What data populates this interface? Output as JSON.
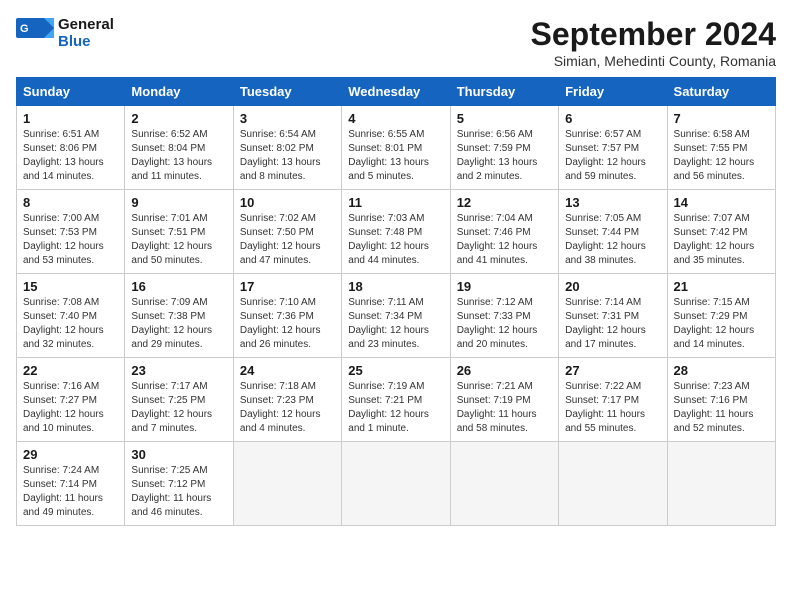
{
  "header": {
    "logo_general": "General",
    "logo_blue": "Blue",
    "month_title": "September 2024",
    "location": "Simian, Mehedinti County, Romania"
  },
  "weekdays": [
    "Sunday",
    "Monday",
    "Tuesday",
    "Wednesday",
    "Thursday",
    "Friday",
    "Saturday"
  ],
  "weeks": [
    [
      {
        "day": "1",
        "info": "Sunrise: 6:51 AM\nSunset: 8:06 PM\nDaylight: 13 hours\nand 14 minutes."
      },
      {
        "day": "2",
        "info": "Sunrise: 6:52 AM\nSunset: 8:04 PM\nDaylight: 13 hours\nand 11 minutes."
      },
      {
        "day": "3",
        "info": "Sunrise: 6:54 AM\nSunset: 8:02 PM\nDaylight: 13 hours\nand 8 minutes."
      },
      {
        "day": "4",
        "info": "Sunrise: 6:55 AM\nSunset: 8:01 PM\nDaylight: 13 hours\nand 5 minutes."
      },
      {
        "day": "5",
        "info": "Sunrise: 6:56 AM\nSunset: 7:59 PM\nDaylight: 13 hours\nand 2 minutes."
      },
      {
        "day": "6",
        "info": "Sunrise: 6:57 AM\nSunset: 7:57 PM\nDaylight: 12 hours\nand 59 minutes."
      },
      {
        "day": "7",
        "info": "Sunrise: 6:58 AM\nSunset: 7:55 PM\nDaylight: 12 hours\nand 56 minutes."
      }
    ],
    [
      {
        "day": "8",
        "info": "Sunrise: 7:00 AM\nSunset: 7:53 PM\nDaylight: 12 hours\nand 53 minutes."
      },
      {
        "day": "9",
        "info": "Sunrise: 7:01 AM\nSunset: 7:51 PM\nDaylight: 12 hours\nand 50 minutes."
      },
      {
        "day": "10",
        "info": "Sunrise: 7:02 AM\nSunset: 7:50 PM\nDaylight: 12 hours\nand 47 minutes."
      },
      {
        "day": "11",
        "info": "Sunrise: 7:03 AM\nSunset: 7:48 PM\nDaylight: 12 hours\nand 44 minutes."
      },
      {
        "day": "12",
        "info": "Sunrise: 7:04 AM\nSunset: 7:46 PM\nDaylight: 12 hours\nand 41 minutes."
      },
      {
        "day": "13",
        "info": "Sunrise: 7:05 AM\nSunset: 7:44 PM\nDaylight: 12 hours\nand 38 minutes."
      },
      {
        "day": "14",
        "info": "Sunrise: 7:07 AM\nSunset: 7:42 PM\nDaylight: 12 hours\nand 35 minutes."
      }
    ],
    [
      {
        "day": "15",
        "info": "Sunrise: 7:08 AM\nSunset: 7:40 PM\nDaylight: 12 hours\nand 32 minutes."
      },
      {
        "day": "16",
        "info": "Sunrise: 7:09 AM\nSunset: 7:38 PM\nDaylight: 12 hours\nand 29 minutes."
      },
      {
        "day": "17",
        "info": "Sunrise: 7:10 AM\nSunset: 7:36 PM\nDaylight: 12 hours\nand 26 minutes."
      },
      {
        "day": "18",
        "info": "Sunrise: 7:11 AM\nSunset: 7:34 PM\nDaylight: 12 hours\nand 23 minutes."
      },
      {
        "day": "19",
        "info": "Sunrise: 7:12 AM\nSunset: 7:33 PM\nDaylight: 12 hours\nand 20 minutes."
      },
      {
        "day": "20",
        "info": "Sunrise: 7:14 AM\nSunset: 7:31 PM\nDaylight: 12 hours\nand 17 minutes."
      },
      {
        "day": "21",
        "info": "Sunrise: 7:15 AM\nSunset: 7:29 PM\nDaylight: 12 hours\nand 14 minutes."
      }
    ],
    [
      {
        "day": "22",
        "info": "Sunrise: 7:16 AM\nSunset: 7:27 PM\nDaylight: 12 hours\nand 10 minutes."
      },
      {
        "day": "23",
        "info": "Sunrise: 7:17 AM\nSunset: 7:25 PM\nDaylight: 12 hours\nand 7 minutes."
      },
      {
        "day": "24",
        "info": "Sunrise: 7:18 AM\nSunset: 7:23 PM\nDaylight: 12 hours\nand 4 minutes."
      },
      {
        "day": "25",
        "info": "Sunrise: 7:19 AM\nSunset: 7:21 PM\nDaylight: 12 hours\nand 1 minute."
      },
      {
        "day": "26",
        "info": "Sunrise: 7:21 AM\nSunset: 7:19 PM\nDaylight: 11 hours\nand 58 minutes."
      },
      {
        "day": "27",
        "info": "Sunrise: 7:22 AM\nSunset: 7:17 PM\nDaylight: 11 hours\nand 55 minutes."
      },
      {
        "day": "28",
        "info": "Sunrise: 7:23 AM\nSunset: 7:16 PM\nDaylight: 11 hours\nand 52 minutes."
      }
    ],
    [
      {
        "day": "29",
        "info": "Sunrise: 7:24 AM\nSunset: 7:14 PM\nDaylight: 11 hours\nand 49 minutes."
      },
      {
        "day": "30",
        "info": "Sunrise: 7:25 AM\nSunset: 7:12 PM\nDaylight: 11 hours\nand 46 minutes."
      },
      {
        "day": "",
        "info": ""
      },
      {
        "day": "",
        "info": ""
      },
      {
        "day": "",
        "info": ""
      },
      {
        "day": "",
        "info": ""
      },
      {
        "day": "",
        "info": ""
      }
    ]
  ]
}
